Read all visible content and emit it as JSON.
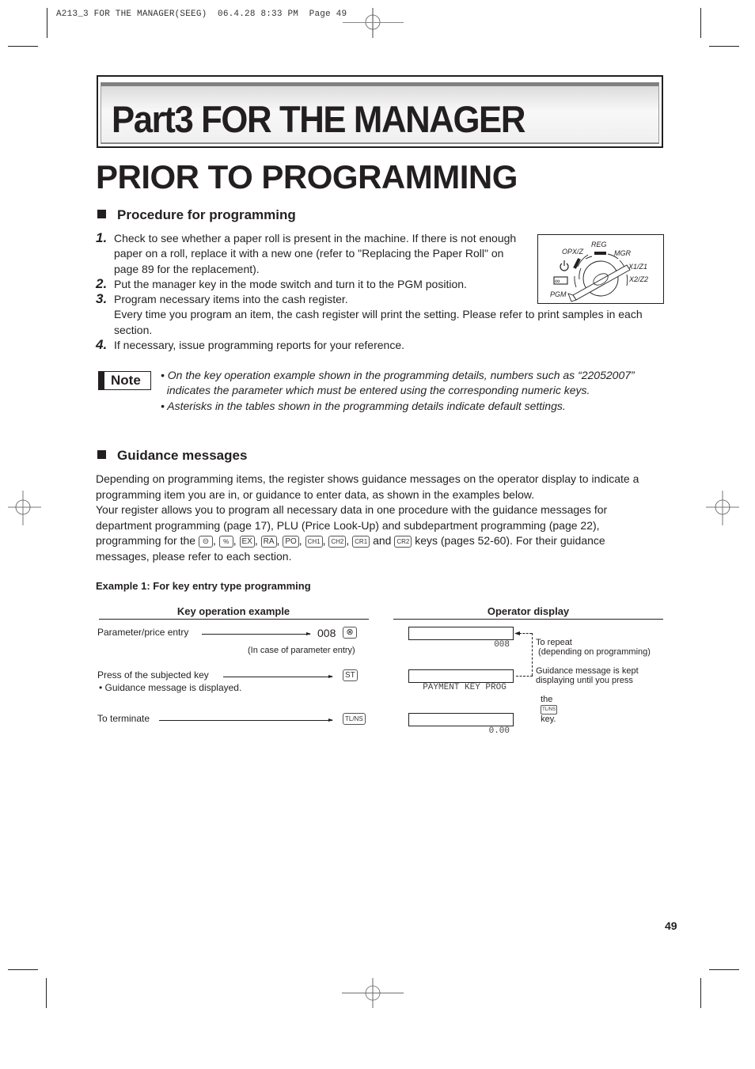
{
  "print_slug": {
    "text": "A213_3 FOR THE MANAGER(SEEG)  06.4.28 8:33 PM  Page 49"
  },
  "part_banner": {
    "title": "Part3  FOR THE MANAGER"
  },
  "main_title": "PRIOR TO PROGRAMMING",
  "procedure": {
    "heading": "Procedure for programming",
    "steps": [
      {
        "number": "1.",
        "lines": [
          "Check to see whether a paper roll is present in the machine.  If there is not enough",
          "paper on a roll, replace it with a new one (refer to \"Replacing the Paper Roll\" on",
          "page 89 for the replacement)."
        ]
      },
      {
        "number": "2.",
        "lines": [
          "Put the manager key in the mode switch and turn it to the PGM position."
        ]
      },
      {
        "number": "3.",
        "lines": [
          "Program necessary items into the cash register.",
          "Every time you program an item, the cash register will print the setting.  Please refer to print samples in each",
          "section."
        ]
      },
      {
        "number": "4.",
        "lines": [
          "If necessary, issue programming reports for your reference."
        ]
      }
    ]
  },
  "mode_switch": {
    "labels": {
      "reg": "REG",
      "opxz": "OPX/Z",
      "mgr": "MGR",
      "x1z1": "X1/Z1",
      "x2z2": "X2/Z2",
      "pgm": "PGM"
    },
    "icons": [
      "power-icon",
      "infinity-icon"
    ],
    "current_position": "PGM"
  },
  "note": {
    "badge": "Note",
    "lines": [
      "• On the key operation example shown in the programming details, numbers such as “22052007”",
      "  indicates the parameter which must be entered using the corresponding numeric keys.",
      "• Asterisks in the tables shown in the programming details indicate default settings."
    ]
  },
  "guidance": {
    "heading": "Guidance messages",
    "para1": [
      "Depending on programming items, the register shows guidance messages on the operator display to indicate a",
      "programming item you are in, or guidance to enter data, as shown in the examples below."
    ],
    "para2": [
      "Your register allows you to program all necessary data in one procedure with the guidance messages for",
      "department programming (page 17), PLU (Price Look-Up) and subdepartment programming (page 22),"
    ],
    "para2_line3_prefix": "programming for the",
    "keys": [
      "⊝",
      "%",
      "EX",
      "RA",
      "PO",
      "CH1",
      "CH2",
      "CR1",
      "CR2"
    ],
    "and_word": "and",
    "para2_line3_suffix": "keys (pages 52-60).  For their guidance",
    "para2_line4": "messages, please refer to each section."
  },
  "example1": {
    "title": "Example 1:  For key entry type programming",
    "key_col_header": "Key operation example",
    "display_col_header": "Operator display",
    "rows": [
      {
        "label": "Parameter/price entry",
        "entry_value": "008",
        "key": "⊗",
        "note": "(In case of parameter entry)",
        "display": "008"
      },
      {
        "label": "Press of the subjected key",
        "sub_note": "• Guidance message is displayed.",
        "key": "ST",
        "display": "PAYMENT KEY PROG"
      },
      {
        "label": "To terminate",
        "key": "TL/NS",
        "display": "0.00"
      }
    ],
    "side_notes": {
      "repeat": "To repeat\n (depending on programming)",
      "guidance_kept_1": "Guidance message is kept\ndisplaying until you press",
      "guidance_kept_prefix": "the",
      "guidance_kept_key": "TL/NS",
      "guidance_kept_suffix": "key."
    }
  },
  "page_number": "49"
}
